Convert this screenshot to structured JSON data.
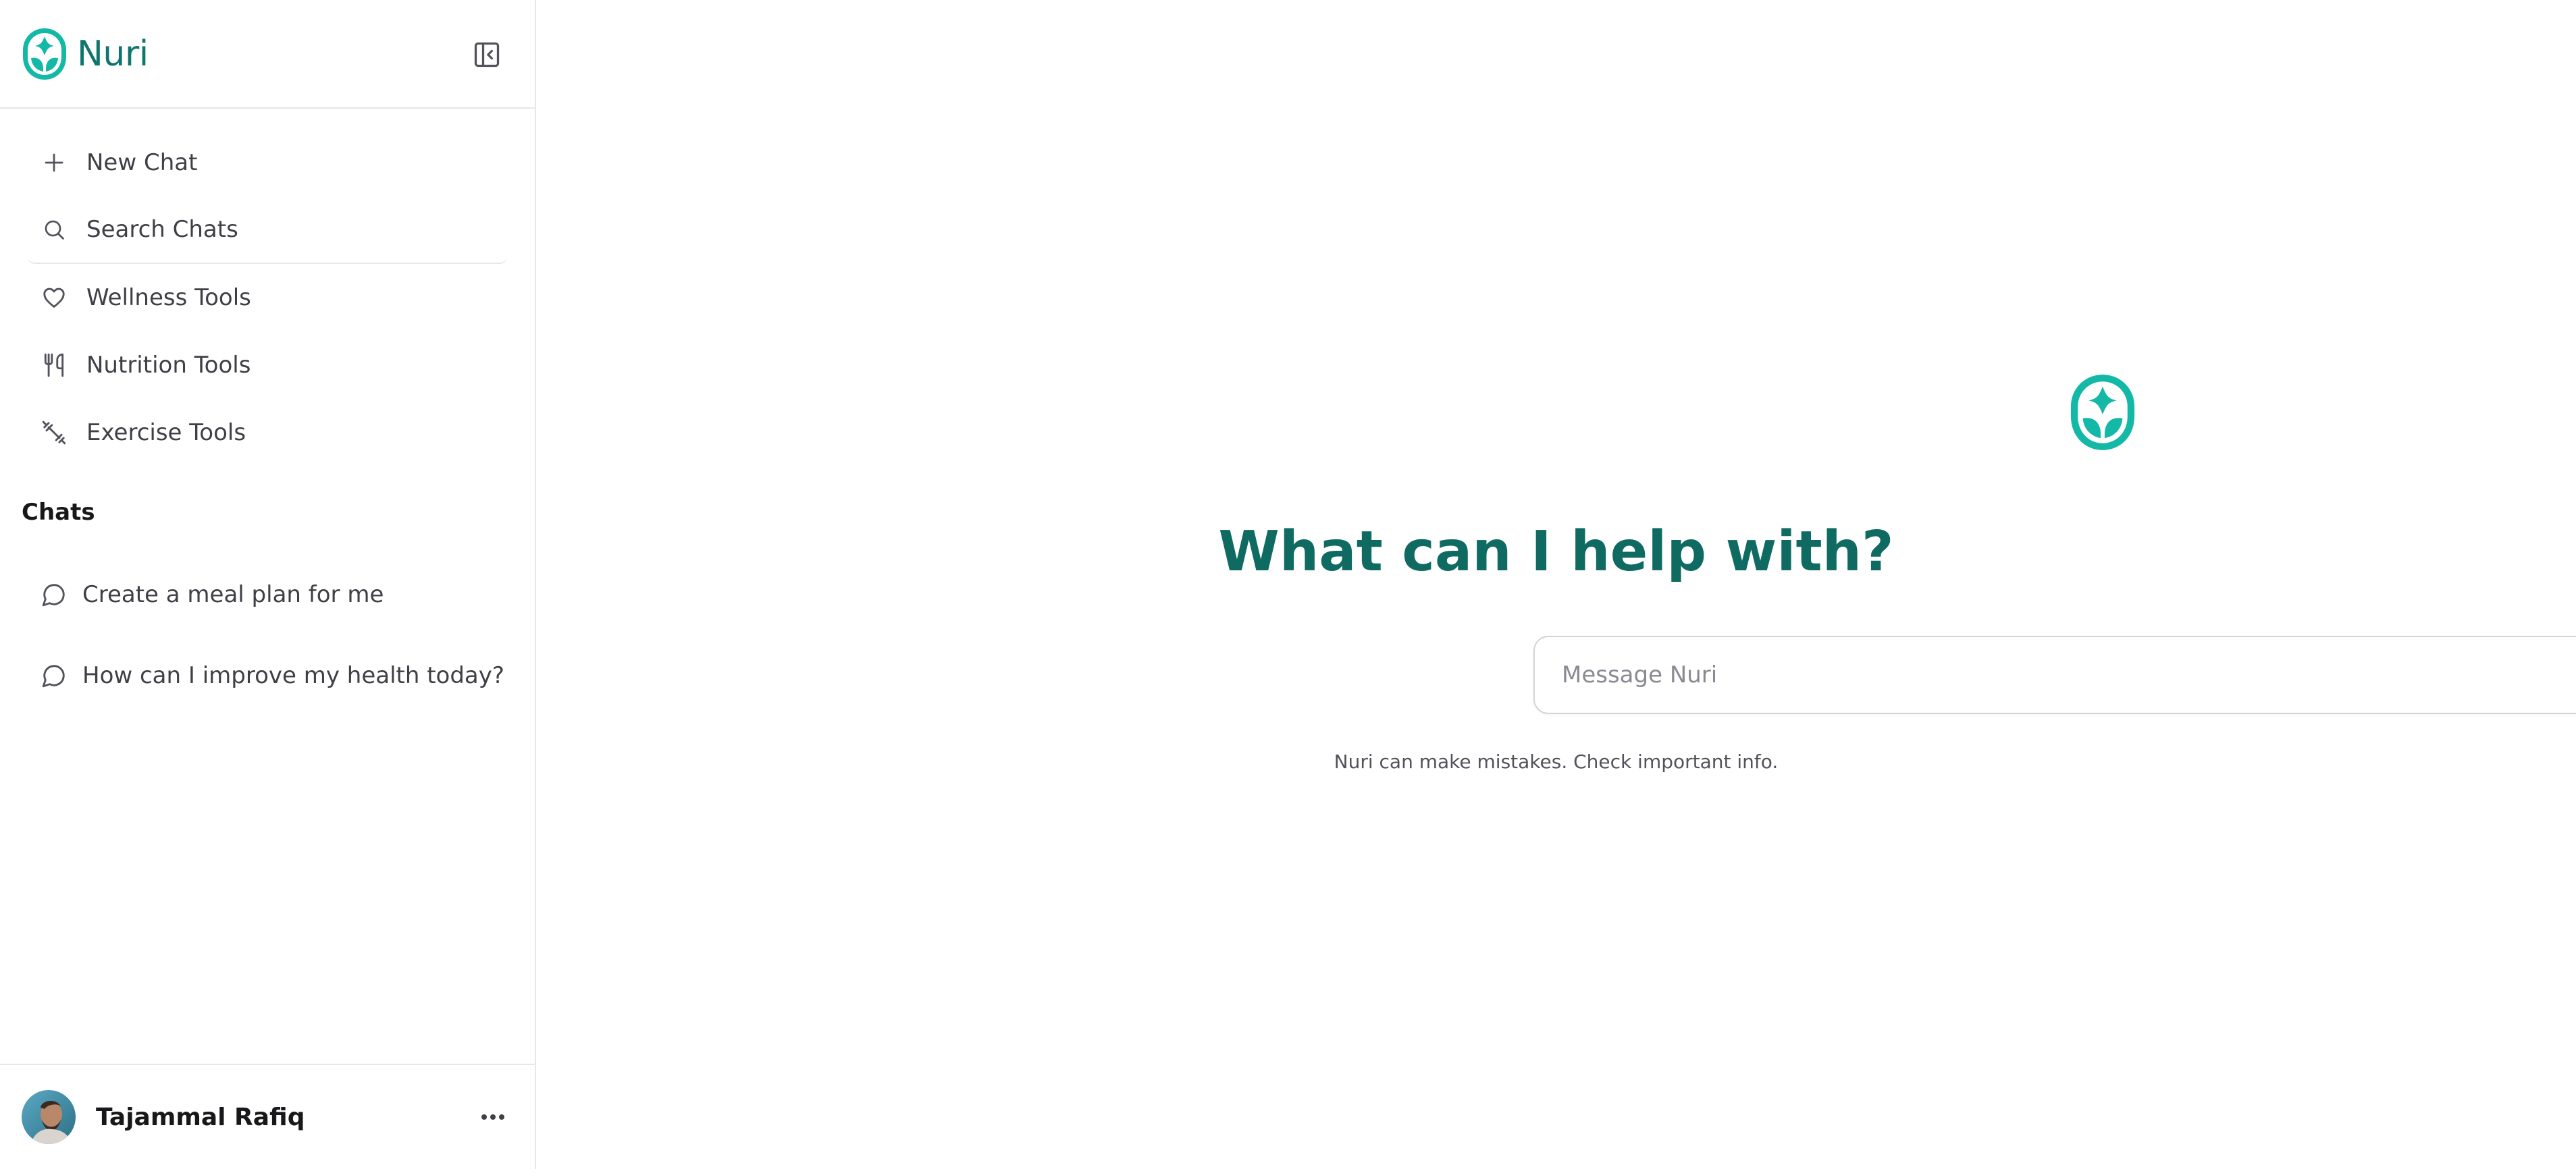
{
  "app": {
    "name": "Nuri"
  },
  "colors": {
    "brand": "#0f766e",
    "brand_light": "#14b8a6",
    "send_button": "#7fd8cc"
  },
  "sidebar": {
    "collapse_icon": "sidebar-collapse-icon",
    "nav": [
      {
        "label": "New Chat",
        "icon": "plus-icon"
      },
      {
        "label": "Search Chats",
        "icon": "search-icon"
      },
      {
        "label": "Wellness Tools",
        "icon": "heart-icon"
      },
      {
        "label": "Nutrition Tools",
        "icon": "utensils-icon"
      },
      {
        "label": "Exercise Tools",
        "icon": "dumbbell-icon"
      }
    ],
    "chats_title": "Chats",
    "chats": [
      {
        "label": "Create a meal plan for me",
        "icon": "message-circle-icon"
      },
      {
        "label": "How can I improve my health today?",
        "icon": "message-circle-icon"
      }
    ],
    "user": {
      "name": "Tajammal Rafiq",
      "more_icon": "ellipsis-icon"
    }
  },
  "main": {
    "headline": "What can I help with?",
    "composer": {
      "placeholder": "Message Nuri",
      "value": "",
      "send_icon": "arrow-up-icon"
    },
    "disclaimer": "Nuri can make mistakes. Check important info."
  }
}
